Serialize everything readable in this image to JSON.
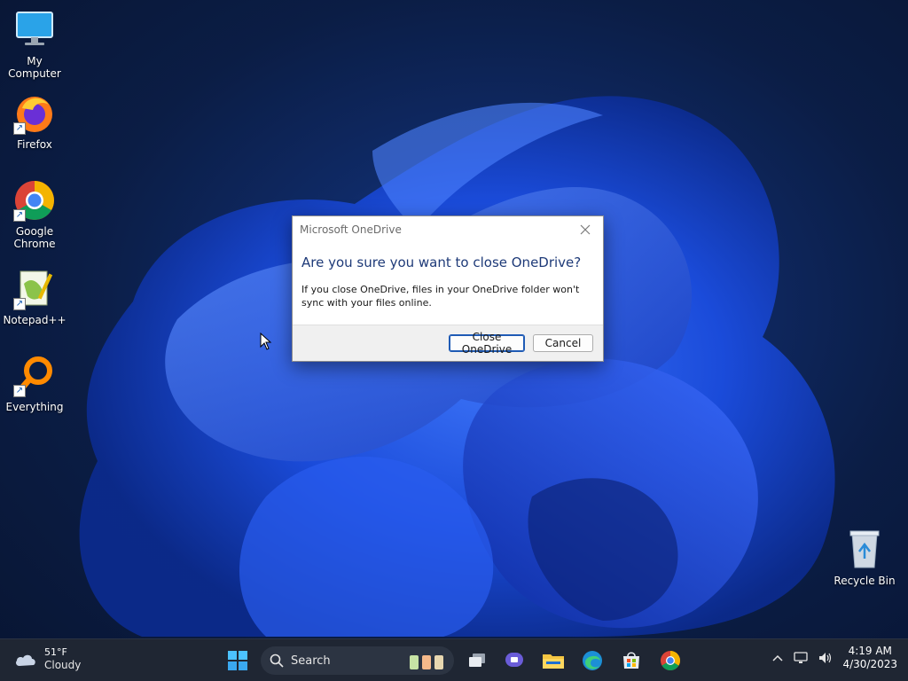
{
  "desktop": {
    "icons": [
      {
        "label": "My Computer"
      },
      {
        "label": "Firefox"
      },
      {
        "label": "Google Chrome"
      },
      {
        "label": "Notepad++"
      },
      {
        "label": "Everything"
      },
      {
        "label": "Recycle Bin"
      }
    ]
  },
  "dialog": {
    "title": "Microsoft OneDrive",
    "heading": "Are you sure you want to close OneDrive?",
    "body": "If you close OneDrive, files in your OneDrive folder won't sync with your files online.",
    "primary_button": "Close OneDrive",
    "secondary_button": "Cancel"
  },
  "taskbar": {
    "weather": {
      "temp": "51°F",
      "condition": "Cloudy",
      "icon": "cloud-icon"
    },
    "search_label": "Search",
    "pinned": [
      {
        "name": "start-icon"
      },
      {
        "name": "task-view-icon"
      },
      {
        "name": "chat-icon"
      },
      {
        "name": "file-explorer-icon"
      },
      {
        "name": "edge-icon"
      },
      {
        "name": "store-icon"
      },
      {
        "name": "chrome-icon"
      }
    ],
    "clock": {
      "time": "4:19 AM",
      "date": "4/30/2023"
    }
  },
  "colors": {
    "dialog_heading": "#1e3a78",
    "primary_border": "#1f5bb5",
    "taskbar_bg": "#1f2633"
  }
}
